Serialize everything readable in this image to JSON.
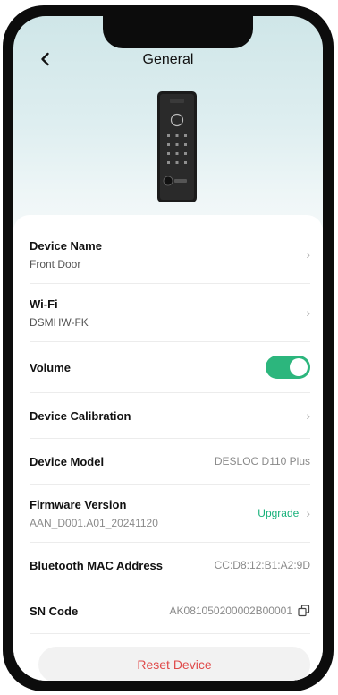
{
  "header": {
    "title": "General"
  },
  "rows": {
    "device_name": {
      "label": "Device Name",
      "value": "Front Door"
    },
    "wifi": {
      "label": "Wi-Fi",
      "value": "DSMHW-FK"
    },
    "volume": {
      "label": "Volume",
      "on": true
    },
    "calibration": {
      "label": "Device Calibration"
    },
    "model": {
      "label": "Device Model",
      "value": "DESLOC D110 Plus"
    },
    "firmware": {
      "label": "Firmware Version",
      "value": "AAN_D001.A01_20241120",
      "action": "Upgrade"
    },
    "mac": {
      "label": "Bluetooth MAC Address",
      "value": "CC:D8:12:B1:A2:9D"
    },
    "sn": {
      "label": "SN Code",
      "value": "AK081050200002B00001"
    }
  },
  "reset": {
    "label": "Reset Device"
  },
  "device_brand": "DESLOC",
  "icons": [
    "back-arrow-icon",
    "chevron-right-icon",
    "copy-icon"
  ],
  "colors": {
    "accent": "#2cb67d",
    "danger": "#e04a4a"
  }
}
